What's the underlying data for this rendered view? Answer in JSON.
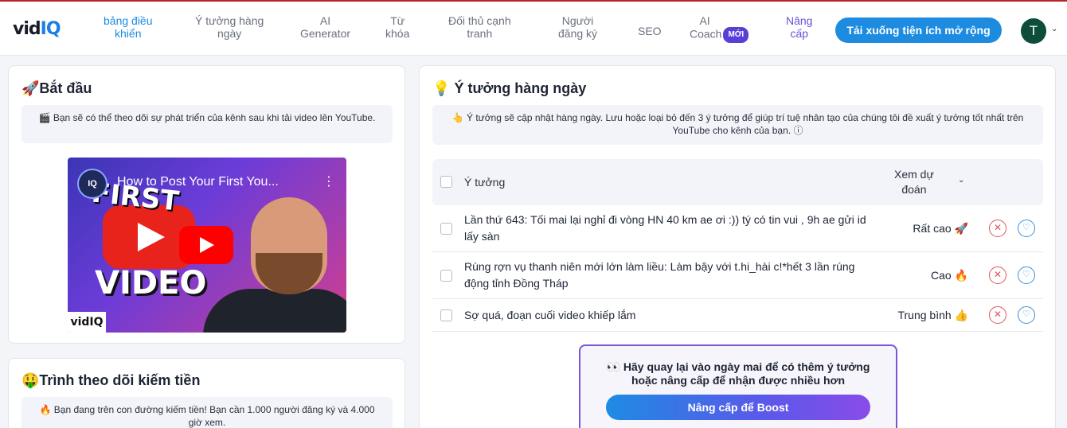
{
  "nav": {
    "logo": {
      "vid": "vid",
      "iq": "IQ"
    },
    "items": [
      {
        "line1": "bảng điều",
        "line2": "khiển"
      },
      {
        "line1": "Ý tưởng hàng",
        "line2": "ngày"
      },
      {
        "line1": "AI",
        "line2": "Generator"
      },
      {
        "line1": "Từ",
        "line2": "khóa"
      },
      {
        "line1": "Đối thủ cạnh",
        "line2": "tranh"
      },
      {
        "line1": "Người",
        "line2": "đăng ký"
      },
      {
        "line1": "SEO"
      },
      {
        "line1": "AI",
        "line2": "Coach",
        "badge": "MỚI"
      },
      {
        "line1": "Nâng",
        "line2": "cấp"
      }
    ],
    "download_button": "Tải xuống tiện ích mở rộng",
    "avatar_letter": "T"
  },
  "start_card": {
    "title": "Bắt đầu",
    "note": "Bạn sẽ có thể theo dõi sự phát triển của kênh sau khi tải video lên YouTube.",
    "video": {
      "title": "How to Post Your First You...",
      "thumb_top": "FIRST",
      "thumb_bottom": "VIDEO",
      "channel": "IQ",
      "watermark": "vidIQ"
    }
  },
  "monetize_card": {
    "title": "Trình theo dõi kiếm tiền",
    "note": "Bạn đang trên con đường kiếm tiền! Bạn cần 1.000 người đăng ký và 4.000 giờ xem."
  },
  "ideas_card": {
    "title": "Ý tưởng hàng ngày",
    "note": "Ý tưởng sẽ cập nhật hàng ngày. Lưu hoặc loại bỏ đến 3 ý tưởng để giúp trí tuệ nhân tạo của chúng tôi đề xuất ý tưởng tốt nhất trên YouTube cho kênh của bạn.",
    "table": {
      "col_idea": "Ý tưởng",
      "col_pred_1": "Xem dự",
      "col_pred_2": "đoán",
      "rows": [
        {
          "text": "Lần thứ 643: Tối mai lại nghỉ đi vòng HN 40 km ae ơi :)) tý có tin vui , 9h ae gửi id lấy sàn",
          "prediction": "Rất cao",
          "emoji": "🚀"
        },
        {
          "text": "Rùng rợn vụ thanh niên mới lớn làm liều: Làm bậy với t.hi_hài c!*hết 3 lần rúng động tỉnh Đồng Tháp",
          "prediction": "Cao",
          "emoji": "🔥"
        },
        {
          "text": "Sợ quá, đoạn cuối video khiếp lắm",
          "prediction": "Trung bình",
          "emoji": "👍"
        }
      ]
    },
    "promo": {
      "text": "👀 Hãy quay lại vào ngày mai để có thêm ý tưởng hoặc nâng cấp để nhận được nhiều hơn",
      "button": "Nâng cấp để Boost"
    }
  },
  "colors": {
    "accent": "#1d8ce0",
    "upgrade": "#6b52d6",
    "badge": "#5a3fd6",
    "reject": "#e0525c"
  }
}
